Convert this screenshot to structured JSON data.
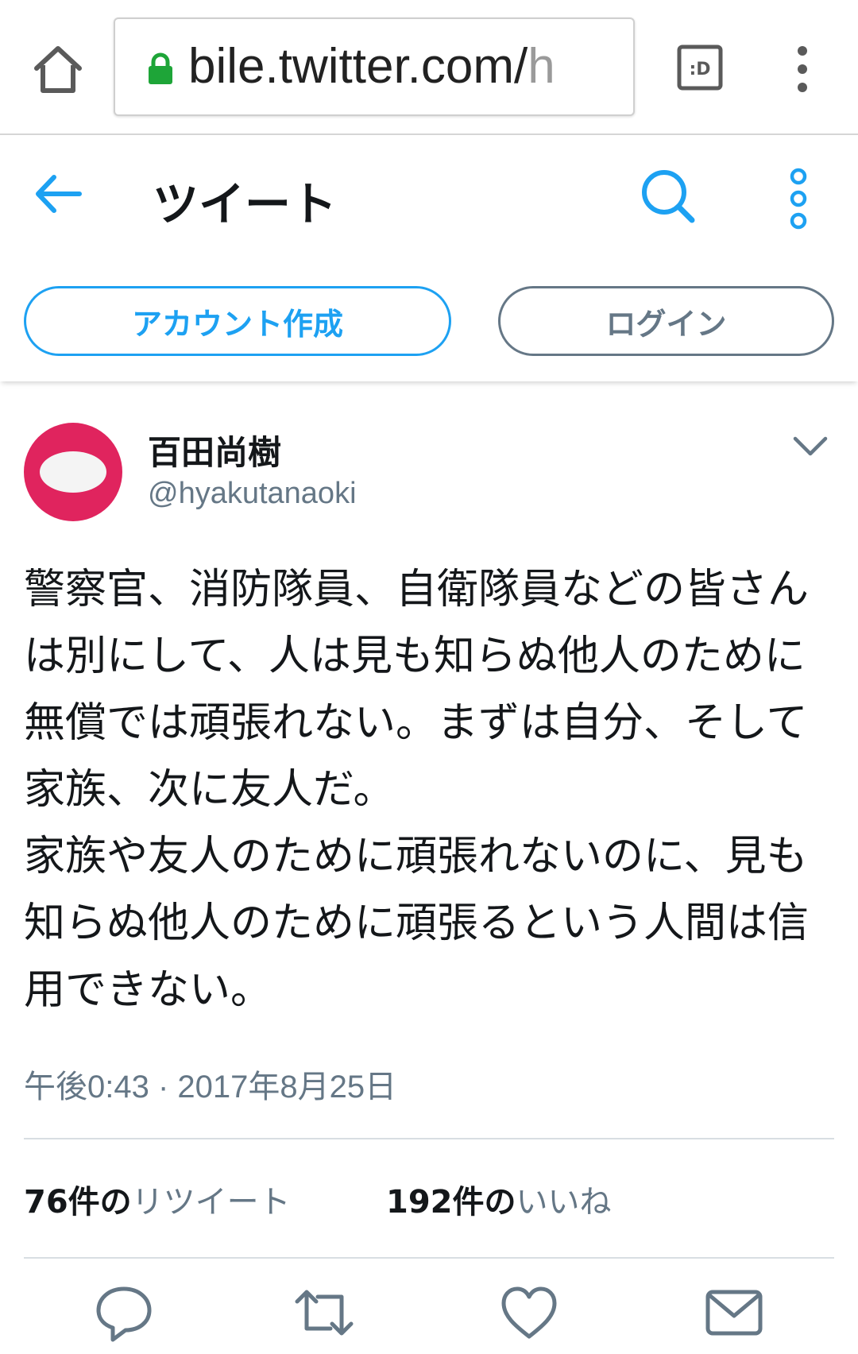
{
  "browser": {
    "url_main": "bile.twitter.com/",
    "url_fade": "h",
    "tab_label": ":D"
  },
  "header": {
    "title": "ツイート",
    "signup_label": "アカウント作成",
    "login_label": "ログイン"
  },
  "tweet": {
    "name": "百田尚樹",
    "handle": "@hyakutanaoki",
    "text": "警察官、消防隊員、自衛隊員などの皆さんは別にして、人は見も知らぬ他人のために無償では頑張れない。まずは自分、そして家族、次に友人だ。\n家族や友人のために頑張れないのに、見も知らぬ他人のために頑張るという人間は信用できない。",
    "timestamp": "午後0:43 · 2017年8月25日",
    "retweets_count": "76件の",
    "retweets_label": "リツイート",
    "likes_count": "192件の",
    "likes_label": "いいね"
  },
  "colors": {
    "accent": "#1da1f2",
    "secondary_text": "#657786",
    "avatar": "#e0245e",
    "lock": "#1ea538"
  },
  "icons": [
    "home-icon",
    "lock-icon",
    "tab-switcher-icon",
    "browser-menu-icon",
    "back-arrow-icon",
    "search-icon",
    "more-vertical-icon",
    "chevron-down-icon",
    "reply-icon",
    "retweet-icon",
    "like-icon",
    "share-mail-icon"
  ]
}
